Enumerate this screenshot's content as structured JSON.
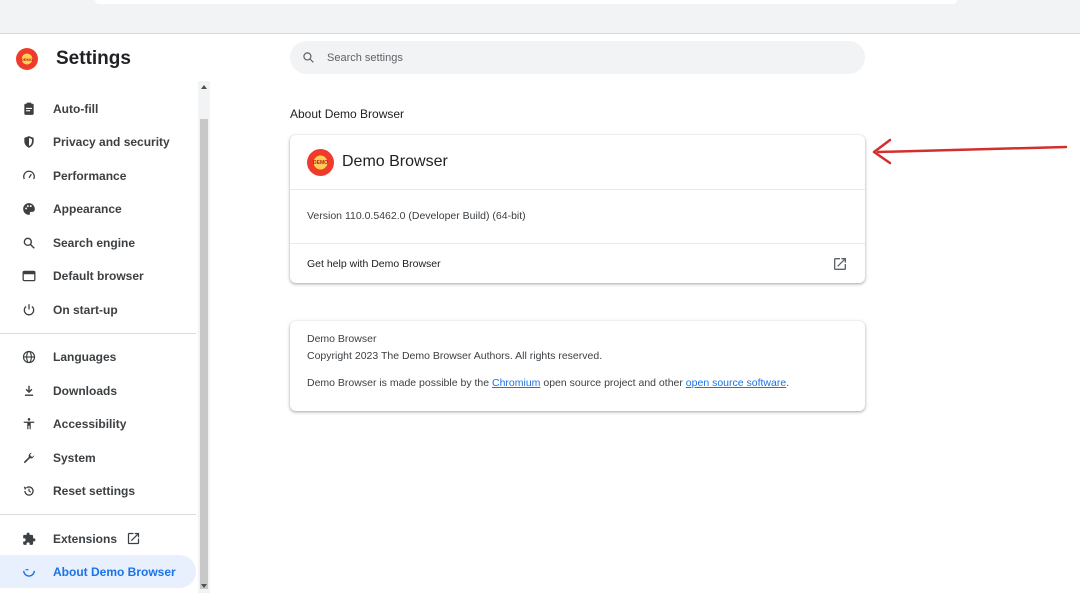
{
  "header": {
    "title": "Settings",
    "logo_text": "DEMO",
    "search_placeholder": "Search settings"
  },
  "sidebar": {
    "items": [
      {
        "label": "Auto-fill",
        "icon": "clipboard-icon"
      },
      {
        "label": "Privacy and security",
        "icon": "shield-icon"
      },
      {
        "label": "Performance",
        "icon": "speedometer-icon"
      },
      {
        "label": "Appearance",
        "icon": "palette-icon"
      },
      {
        "label": "Search engine",
        "icon": "search-icon"
      },
      {
        "label": "Default browser",
        "icon": "browser-window-icon"
      },
      {
        "label": "On start-up",
        "icon": "power-icon"
      },
      {
        "label": "Languages",
        "icon": "globe-icon"
      },
      {
        "label": "Downloads",
        "icon": "download-icon"
      },
      {
        "label": "Accessibility",
        "icon": "accessibility-icon"
      },
      {
        "label": "System",
        "icon": "wrench-icon"
      },
      {
        "label": "Reset settings",
        "icon": "reset-icon"
      },
      {
        "label": "Extensions",
        "icon": "puzzle-icon"
      },
      {
        "label": "About Demo Browser",
        "icon": "browser-logo-icon",
        "active": true
      }
    ]
  },
  "main": {
    "section_title": "About Demo Browser",
    "app_name": "Demo Browser",
    "app_logo_text": "DEMO",
    "version": "Version 110.0.5462.0 (Developer Build) (64-bit)",
    "help_label": "Get help with Demo Browser",
    "credits": {
      "name": "Demo Browser",
      "copyright": "Copyright 2023 The Demo Browser Authors. All rights reserved.",
      "made_possible_prefix": "Demo Browser is made possible by the ",
      "chromium_link": "Chromium",
      "made_possible_middle": " open source project and other ",
      "oss_link": "open source software",
      "made_possible_suffix": "."
    }
  },
  "colors": {
    "accent": "#1a73e8",
    "active_bg": "#e8f0fe",
    "annotation_arrow": "#d32f2f"
  }
}
